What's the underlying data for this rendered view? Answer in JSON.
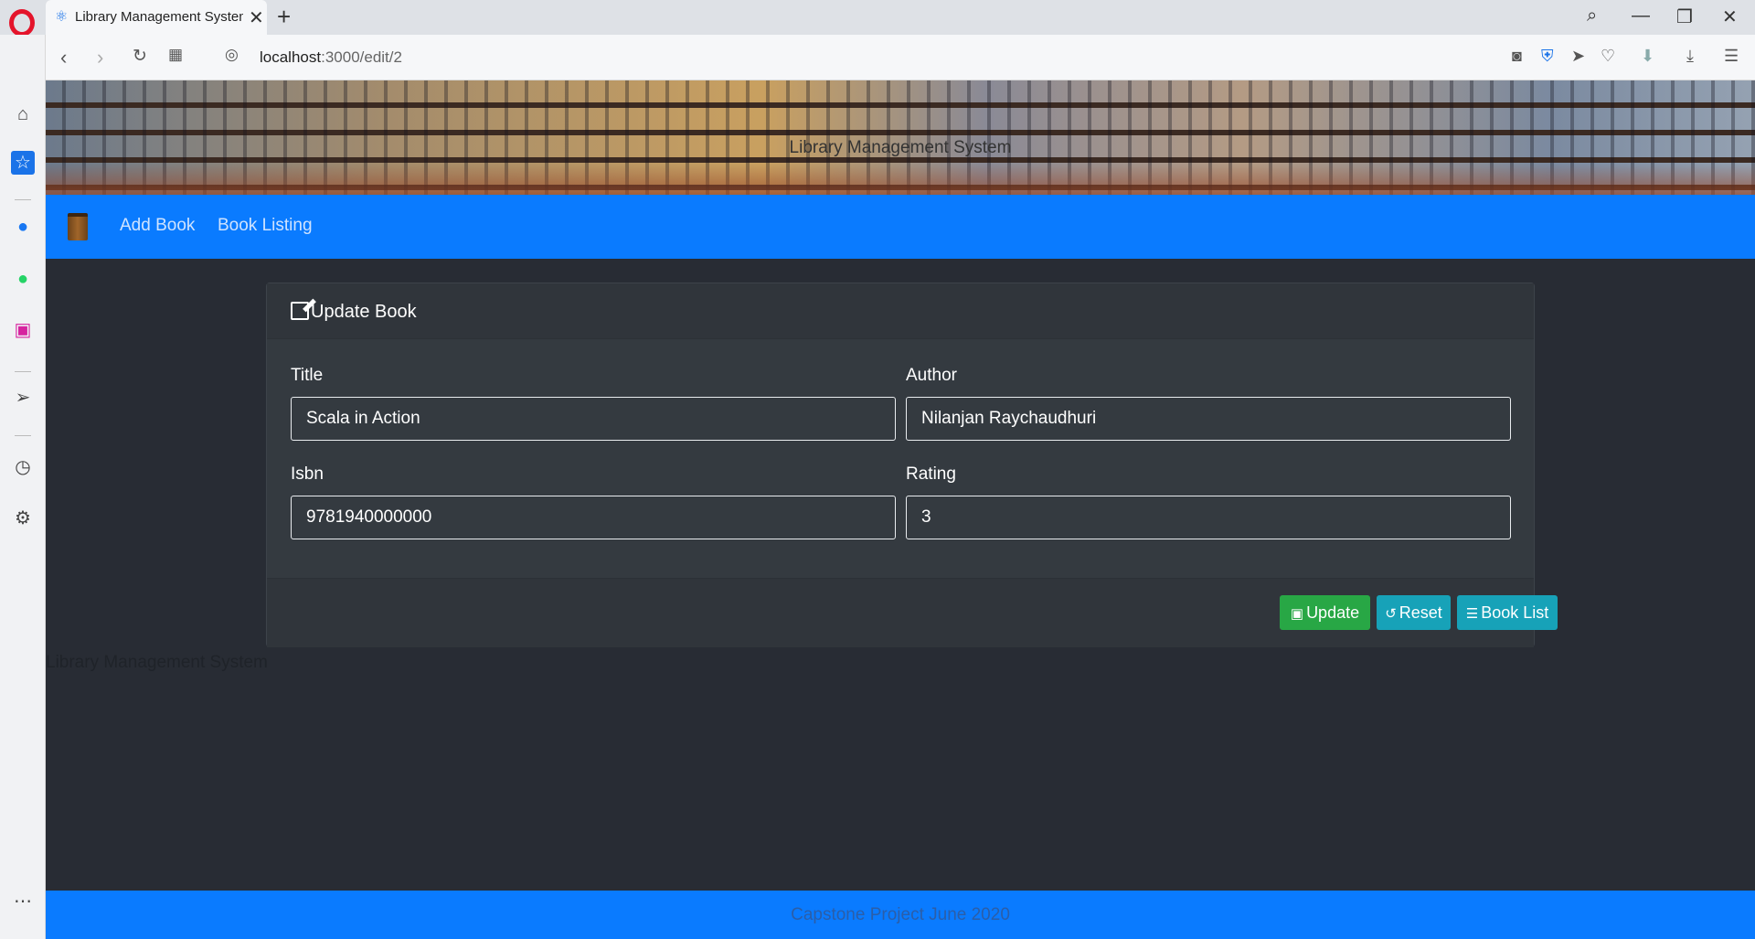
{
  "browser": {
    "tab_title": "Library Management System",
    "url_host": "localhost",
    "url_rest": ":3000/edit/2",
    "icons": [
      "opera-icon",
      "react-favicon",
      "close-icon",
      "plus-icon",
      "search-icon",
      "minimize-icon",
      "restore-icon",
      "close-window-icon",
      "back-icon",
      "forward-icon",
      "reload-icon",
      "tabs-grid-icon",
      "site-info-icon",
      "camera-icon",
      "shield-icon",
      "send-icon",
      "heart-icon",
      "download-arrow-icon",
      "download-icon",
      "easy-setup-icon"
    ]
  },
  "sidebar": {
    "icons": [
      "home-icon",
      "bookmark-star-icon",
      "messenger-icon",
      "whatsapp-icon",
      "instagram-icon",
      "send-icon",
      "history-icon",
      "settings-icon",
      "more-icon"
    ]
  },
  "app": {
    "banner_title": "Library Management System",
    "nav": {
      "logo": "book-icon",
      "links": [
        "Add Book",
        "Book Listing"
      ]
    },
    "card": {
      "title": "Update Book",
      "fields": {
        "title": {
          "label": "Title",
          "value": "Scala in Action"
        },
        "author": {
          "label": "Author",
          "value": "Nilanjan Raychaudhuri"
        },
        "isbn": {
          "label": "Isbn",
          "value": "9781940000000"
        },
        "rating": {
          "label": "Rating",
          "value": "3"
        }
      },
      "buttons": {
        "update": "Update",
        "reset": "Reset",
        "book_list": "Book List"
      }
    },
    "ghost_text": "Library Management System",
    "footer": "Capstone Project June 2020",
    "colors": {
      "primary": "#0a7bff",
      "success": "#28a745",
      "info": "#17a2b8",
      "background": "#282c34",
      "card": "#343a40"
    }
  }
}
